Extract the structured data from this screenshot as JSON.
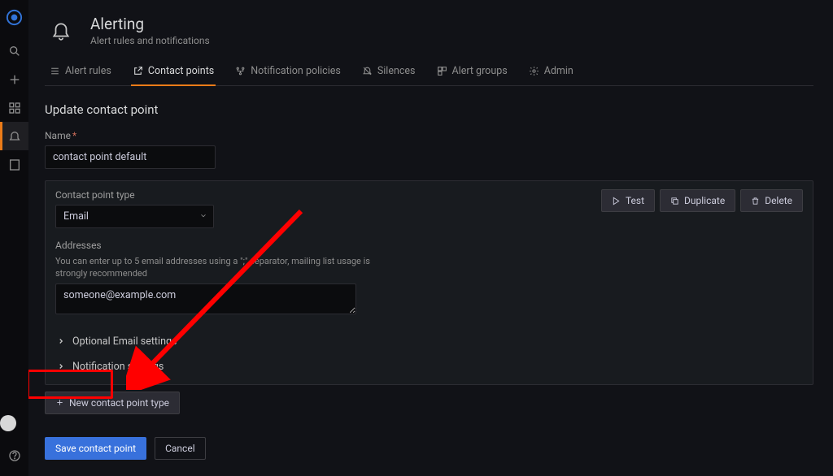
{
  "page": {
    "title": "Alerting",
    "subtitle": "Alert rules and notifications"
  },
  "tabs": [
    {
      "label": "Alert rules",
      "active": false
    },
    {
      "label": "Contact points",
      "active": true
    },
    {
      "label": "Notification policies",
      "active": false
    },
    {
      "label": "Silences",
      "active": false
    },
    {
      "label": "Alert groups",
      "active": false
    },
    {
      "label": "Admin",
      "active": false
    }
  ],
  "section": {
    "title": "Update contact point"
  },
  "form": {
    "name_label": "Name",
    "name_value": "contact point default",
    "type_label": "Contact point type",
    "type_value": "Email",
    "addresses_label": "Addresses",
    "addresses_desc": "You can enter up to 5 email addresses using a \";\" separator, mailing list usage is strongly recommended",
    "addresses_value": "someone@example.com",
    "optional_label": "Optional Email settings",
    "notification_label": "Notification settings"
  },
  "buttons": {
    "test": "Test",
    "duplicate": "Duplicate",
    "delete": "Delete",
    "new_type": "New contact point type",
    "save": "Save contact point",
    "cancel": "Cancel"
  }
}
